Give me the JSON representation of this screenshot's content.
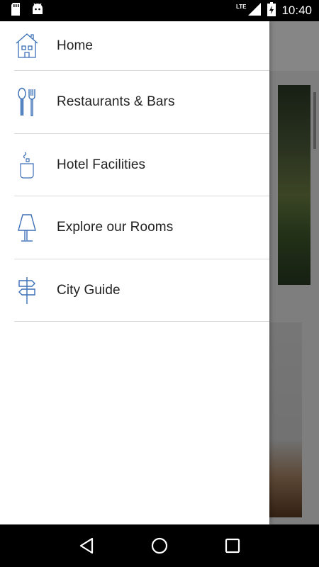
{
  "status_bar": {
    "time": "10:40",
    "network": "LTE",
    "icons": [
      "sd-card-icon",
      "android-icon",
      "signal-icon",
      "battery-icon"
    ]
  },
  "drawer": {
    "items": [
      {
        "label": "Home",
        "icon": "house-icon"
      },
      {
        "label": "Restaurants & Bars",
        "icon": "spoon-fork-icon"
      },
      {
        "label": "Hotel Facilities",
        "icon": "cup-icon"
      },
      {
        "label": "Explore our Rooms",
        "icon": "lamp-icon"
      },
      {
        "label": "City Guide",
        "icon": "signpost-icon"
      }
    ]
  },
  "colors": {
    "icon_stroke": "#3b6fb6",
    "drawer_bg": "#ffffff",
    "text": "#222222"
  },
  "nav_bar": {
    "buttons": [
      "back-icon",
      "home-icon",
      "recents-icon"
    ]
  }
}
